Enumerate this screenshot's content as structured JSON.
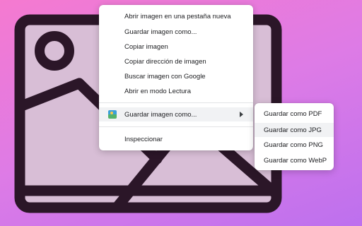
{
  "background": {
    "gradient_colors": [
      "#f57ad0",
      "#dd7be6",
      "#bd70ee"
    ],
    "illustration_icon": "image-placeholder-icon",
    "illustration_colors": {
      "outline": "#2b1628",
      "fill": "#d8bed6"
    }
  },
  "context_menu": {
    "items": [
      {
        "label": "Abrir imagen en una pestaña nueva"
      },
      {
        "label": "Guardar imagen como..."
      },
      {
        "label": "Copiar imagen"
      },
      {
        "label": "Copiar dirección de imagen"
      },
      {
        "label": "Buscar imagen con Google"
      },
      {
        "label": "Abrir en modo Lectura"
      }
    ],
    "extension_item": {
      "label": "Guardar imagen como...",
      "icon": "extension-image-icon",
      "submenu_arrow": "chevron-right-icon"
    },
    "inspect_label": "Inspeccionar"
  },
  "submenu": {
    "items": [
      {
        "label": "Guardar como PDF"
      },
      {
        "label": "Guardar como JPG"
      },
      {
        "label": "Guardar como PNG"
      },
      {
        "label": "Guardar como WebP"
      }
    ],
    "highlighted_index": 1,
    "highlight_color": "#f1f2f4"
  }
}
